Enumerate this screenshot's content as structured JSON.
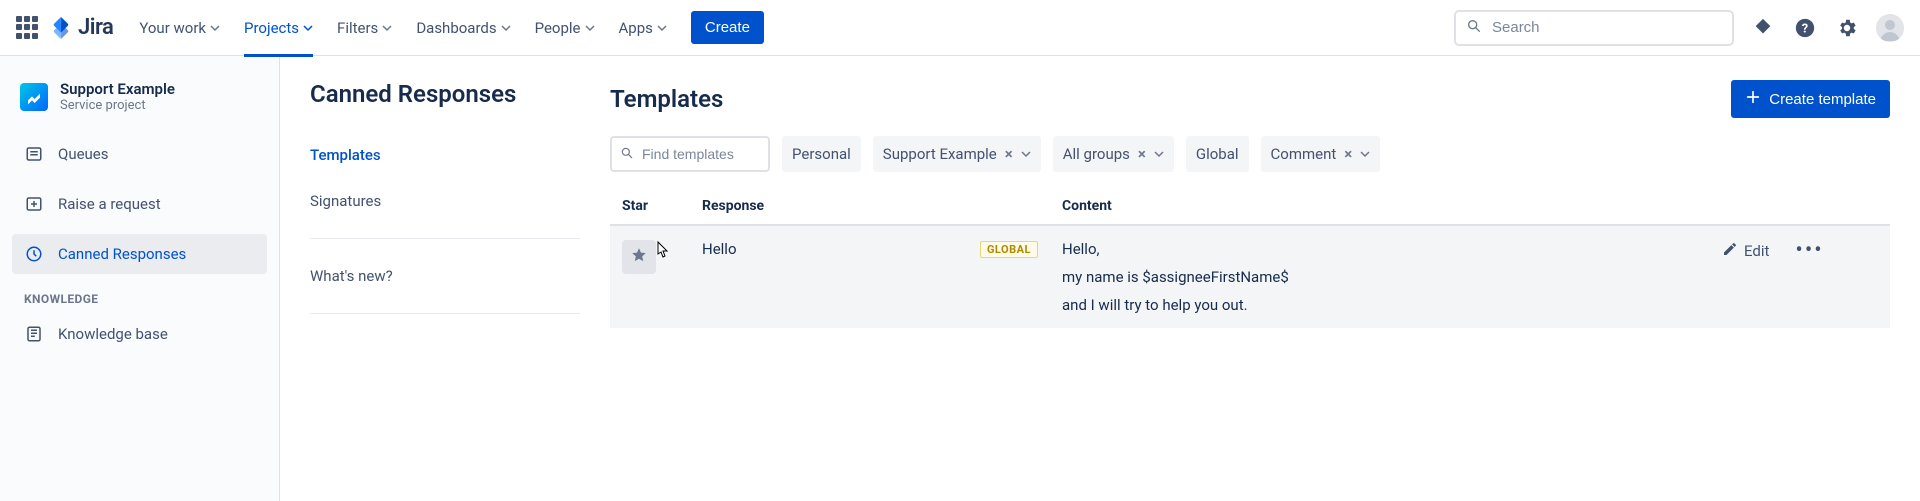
{
  "topnav": {
    "product": "Jira",
    "menus": [
      {
        "label": "Your work",
        "active": false,
        "has_caret": true
      },
      {
        "label": "Projects",
        "active": true,
        "has_caret": true
      },
      {
        "label": "Filters",
        "active": false,
        "has_caret": true
      },
      {
        "label": "Dashboards",
        "active": false,
        "has_caret": true
      },
      {
        "label": "People",
        "active": false,
        "has_caret": true
      },
      {
        "label": "Apps",
        "active": false,
        "has_caret": true
      }
    ],
    "create_label": "Create",
    "search_placeholder": "Search"
  },
  "project": {
    "name": "Support Example",
    "subtitle": "Service project"
  },
  "sidebar": {
    "items": [
      {
        "icon": "queues",
        "label": "Queues",
        "selected": false
      },
      {
        "icon": "raise",
        "label": "Raise a request",
        "selected": false
      },
      {
        "icon": "canned",
        "label": "Canned Responses",
        "selected": true
      }
    ],
    "section_heading": "KNOWLEDGE",
    "knowledge_items": [
      {
        "icon": "kb",
        "label": "Knowledge base",
        "selected": false
      }
    ]
  },
  "subnav": {
    "title": "Canned Responses",
    "items": [
      {
        "label": "Templates",
        "active": true
      },
      {
        "label": "Signatures",
        "active": false
      }
    ],
    "footer_item": "What's new?"
  },
  "content": {
    "title": "Templates",
    "create_button": "Create template",
    "find_placeholder": "Find templates",
    "filters": [
      {
        "label": "Personal",
        "clearable": false,
        "caret": false
      },
      {
        "label": "Support Example",
        "clearable": true,
        "caret": true
      },
      {
        "label": "All groups",
        "clearable": true,
        "caret": true
      },
      {
        "label": "Global",
        "clearable": false,
        "caret": false
      },
      {
        "label": "Comment",
        "clearable": true,
        "caret": true
      }
    ],
    "columns": {
      "star": "Star",
      "response": "Response",
      "content": "Content"
    },
    "rows": [
      {
        "starred": false,
        "name": "Hello",
        "scope": "GLOBAL",
        "content_lines": [
          "Hello,",
          "my name is $assigneeFirstName$",
          "and I will try to help you out."
        ],
        "edit_label": "Edit"
      }
    ]
  }
}
